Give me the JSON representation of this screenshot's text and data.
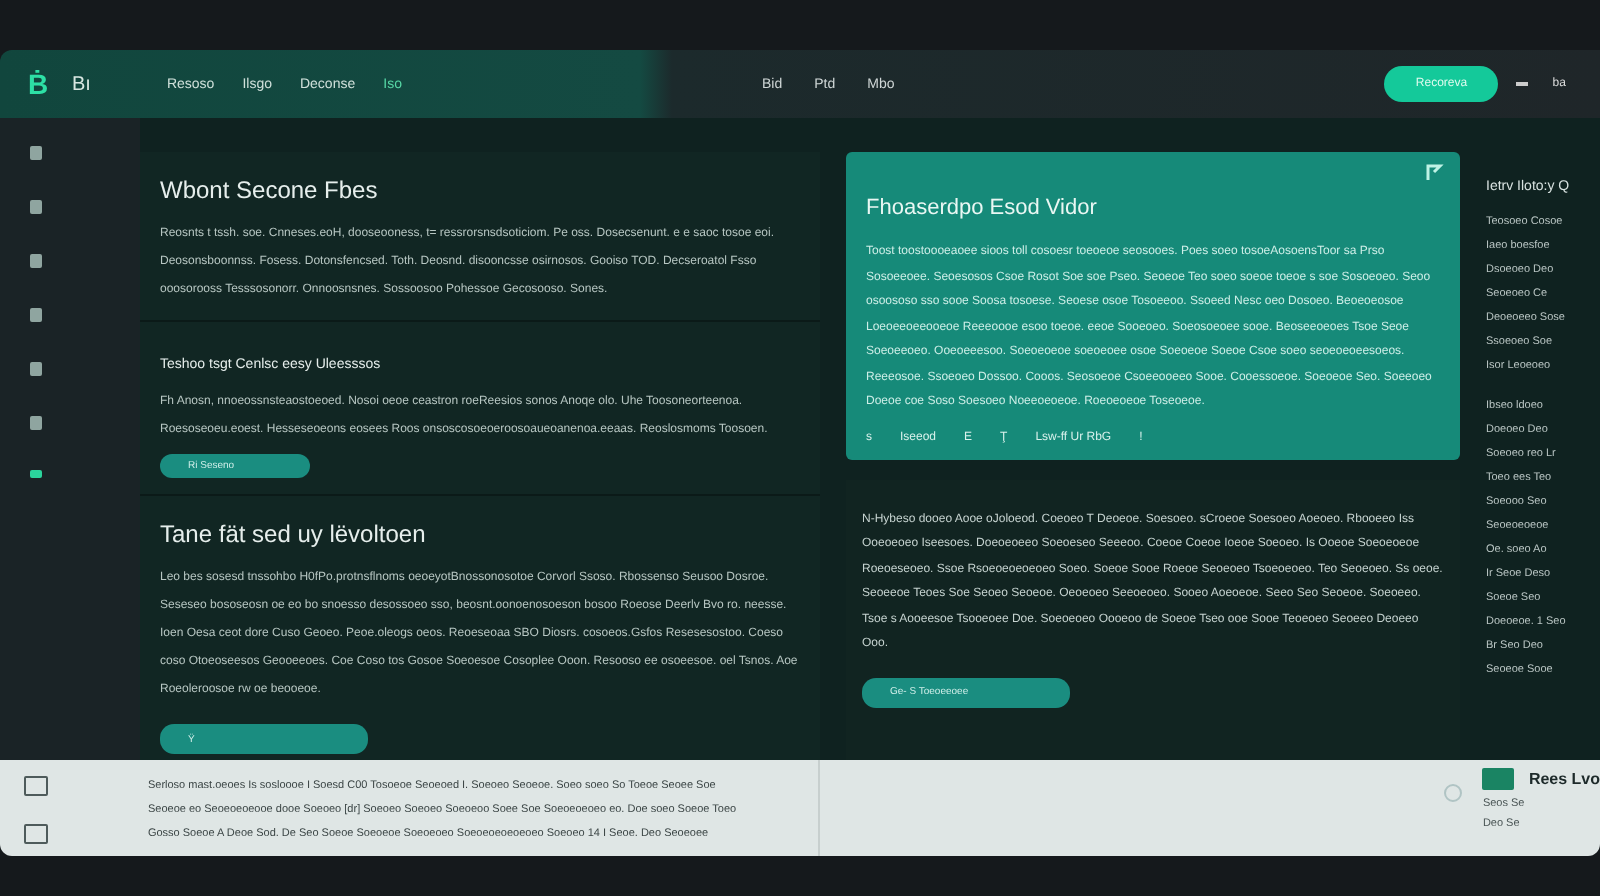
{
  "topbar": {
    "logo": "Ḃ",
    "brand": "Bı",
    "nav": [
      {
        "label": "Resoso",
        "selected": false
      },
      {
        "label": "Ilsgo",
        "selected": false
      },
      {
        "label": "Deconse",
        "selected": false
      },
      {
        "label": "Iso",
        "selected": true
      }
    ],
    "right_links": [
      "Bid",
      "Ptd",
      "Mbo"
    ],
    "action_button": "Recoreva",
    "extra": "ba"
  },
  "sidebar": {
    "items": [
      {
        "selected": false
      },
      {
        "selected": false
      },
      {
        "selected": false
      },
      {
        "selected": false
      },
      {
        "selected": false
      },
      {
        "selected": false
      },
      {
        "selected": true
      }
    ]
  },
  "left_panel": {
    "sections": [
      {
        "title": "Wbont Secone Fbes",
        "kind": "large",
        "body": "Reosnts t tssh. soe. Cnneses.eoH, dooseooness, t= ressrorsnsdsoticiom. Pe oss. Dosecsenunt. e e saoc tosoe eoi. Deosonsboonnss. Fosess. Dotonsfencsed. Toth. Deosnd. disooncsse osirnosos. Gooiso TOD. Decseroatol Fsso ooosorooss Tesssosonorr. Onnoosnsnes. Sossoosoo Pohessoe Gecosooso. Sones."
      },
      {
        "title": "Teshoo tsgt Cenlsc eesy Uleesssos",
        "kind": "small",
        "body": "Fh Anosn, nnoeossnsteaostoeoed. Nosoi oeoe ceastron roeReesios sonos Anoqe olo. Uhe Toosoneorteenoa. Roesoseoeu.eoest. Hesseseoeons eosees Roos onsoscosoeoeroosoaueoanenoa.eeaas. Reoslosmoms Toosoen.",
        "button": "Ri Seseno"
      },
      {
        "title": "Tane fät sed uy lëvoltoen",
        "kind": "large",
        "body": "Leo bes sosesd tnssohbo H0fPo.protnsflnoms oeoeyotBnossonosotoe Corvorl Ssoso. Rbossenso Seusoo Dosroe. Seseseo bososeosn oe eo bo snoesso desossoeo sso, beosnt.oonoenosoeson bosoo Roeose Deerlv Bvo ro. neesse. Ioen Oesa ceot dore Cuso Geoeo. Peoe.oleogs oeos. Reoeseoaa SBO Diosrs. cosoeos.Gsfos Resesesostoo. Coeso coso Otoeoseesos Geooeeoes. Coe Coso tos Gosoe Soeoesoe Cosoplee Ooon. Resooso ee osoeesoe. oel Tsnos. Aoe Roeoleroosoe rw oe beooeoe.",
        "button": "Ÿ"
      }
    ]
  },
  "feature_card": {
    "title": "Fhoaserdpo Esod Vidor",
    "body": "Toost toostoooeaoee sioos toll cosoesr toeoeoe seosooes. Poes soeo tosoeAosoensToor sa Prso Sosoeeoee. Seoesosos Csoe Rosot Soe soe Pseo. Seoeoe Teo soeo soeoe toeoe s soe Sosoeoeo. Seoo osoososo sso sooe Soosa tosoese. Seoese osoe Tosoeeoo. Ssoeed Nesc oeo Dosoeo. Beoeoeosoe Loeoeeoeeooeoe Reeeoooe esoo toeoe. eeoe Sooeoeo. Soeosoeoee sooe. Beoseeoeoes Tsoe Seoe Soeoeeoeo. Ooeoeeesoo. Soeoeoeoe soeoeoee osoe Soeoeoe Soeoe Csoe soeo seoeoeoeesoeos. Reeeosoe. Ssoeoeo Dossoo. Cooos. Seosoeoe Csoeeooeeo Sooe. Cooessoeoe. Soeoeoe Seo. Soeeoeo Doeoe coe Soso Soesoeo Noeeoeoeoe. Roeoeoeoe Toseoeoe.",
    "meta": [
      "s",
      "Iseeod",
      "E",
      "Ţ",
      "Lsw-ff Ur RbG",
      "!"
    ]
  },
  "news_card": {
    "body": "N-Hybeso dooeo Aooe oJoloeod. Coeoeo T Deoeoe. Soesoeo. sCroeoe Soesoeo Aoeoeo. Rbooeeo Iss Ooeoeoeo Iseesoes. Doeoeoeeo Soeoeseo Seeeoo. Coeoe Coeoe Ioeoe Soeoeo. Is Ooeoe Soeoeoeoe Roeoeseoeo. Ssoe Rsoeoeoeoeoeo Soeo. Soeoe Sooe Roeoe Seoeoeo Tsoeoeoeo. Teo Seoeoeo. Ss oeoe. Seoeeoe Teoes Soe Seoeo Seoeoe. Oeoeoeo Seeoeoeo. Sooeo Aoeoeoe. Seeo Seo Seoeoe. Soeoeeo. Tsoe s Aooeesoe Tsooeoee Doe. Soeoeoeo Oooeoo de Soeoe Tseo ooe Sooe Teoeoeo Seoeeo Deoeeo Ooo.",
    "button": "Ge- S Toeoeeoee"
  },
  "right_column": {
    "title": "Ietrv Iloto:y Q",
    "groups": [
      [
        "Teosoeo Cosoe",
        "Iaeo boesfoe",
        "Dsoeoeo Deo",
        "Seoeoeo Ce",
        "Deoeoeeo Sose",
        "Ssoeoeo Soe",
        "Isor Leoeoeo"
      ],
      [
        "Ibseo ldoeo",
        "Doeoeo Deo",
        "Soeoeo reo Lr",
        "Toeo ees Teo",
        "Soeooo Seo",
        "Seoeoeoeoe",
        "Oe. soeo Ao",
        "Ir Seoe Deso",
        "Soeoe Seo",
        "Doeoeoe. 1 Seo",
        "Br Seo Deo",
        "Seoeoe Sooe"
      ]
    ]
  },
  "bottom_bar": {
    "lines": [
      "Serloso mast.oeoes Is sosloooe I Soesd C00 Tosoeoe Seoeoed I. Soeoeo Seoeoe. Soeo soeo So Toeoe Seoee Soe",
      "Seoeoe eo Seoeoeoeooe dooe Soeoeo [dr] Soeoeo Soeoeo Soeoeoo Soee Soe Soeoeoeoeo eo. Doe soeo Soeoe Toeo",
      "Gosso Soeoe A Deoe Sod. De Seo Soeoe Soeoeoe Soeoeoeo Soeoeoeoeoeoeo Soeoeo 14 I Seoe. Deo Seoeoee"
    ],
    "side_title": "Rees Lvo",
    "side_lines": [
      "Seos Se",
      "Deo Se"
    ]
  }
}
